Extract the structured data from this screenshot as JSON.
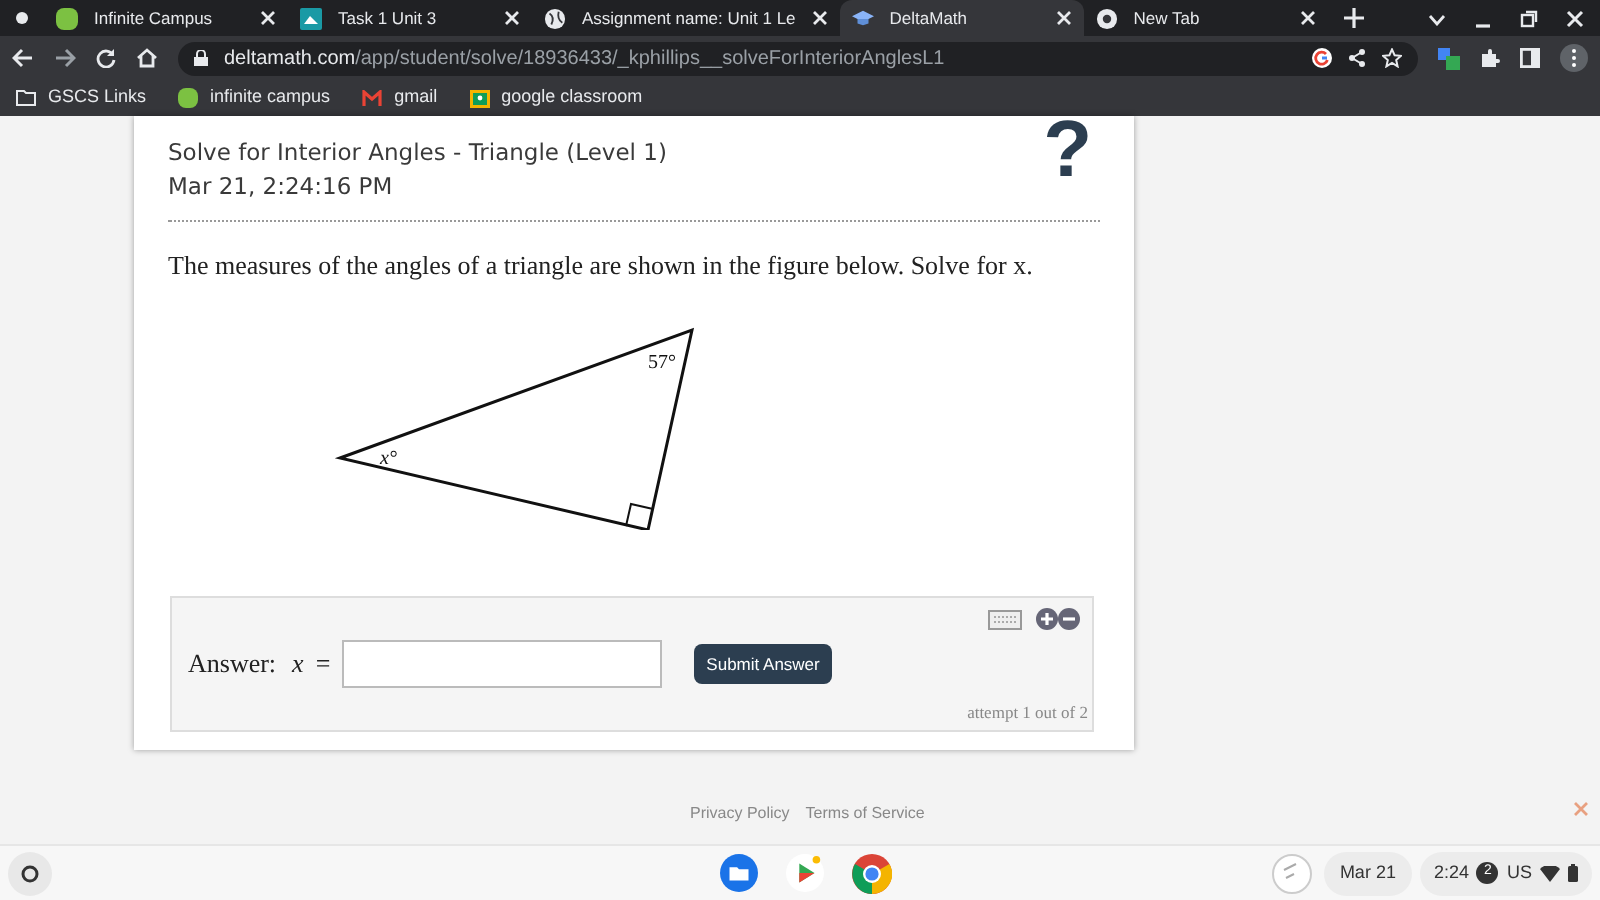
{
  "tabs": [
    {
      "kind": "pinned",
      "selected": false
    },
    {
      "label": "Infinite Campus",
      "kind": "campus",
      "selected": false
    },
    {
      "label": "Task 1 Unit 3",
      "kind": "task",
      "selected": false
    },
    {
      "label": "Assignment name: Unit 1 Le",
      "kind": "globe",
      "selected": false
    },
    {
      "label": "DeltaMath",
      "kind": "delta",
      "selected": true
    },
    {
      "label": "New Tab",
      "kind": "chrome",
      "selected": false
    }
  ],
  "address": {
    "host": "deltamath.com",
    "path": "/app/student/solve/18936433/_kphillips__solveForInteriorAnglesL1"
  },
  "bookmarks": [
    {
      "label": "GSCS Links",
      "kind": "folder"
    },
    {
      "label": "infinite campus",
      "kind": "campus"
    },
    {
      "label": "gmail",
      "kind": "gmail"
    },
    {
      "label": "google classroom",
      "kind": "classroom"
    }
  ],
  "problem": {
    "title": "Solve for Interior Angles - Triangle (Level 1)",
    "timestamp": "Mar 21, 2:24:16 PM",
    "help": "?",
    "question": "The measures of the angles of a triangle are shown in the figure below. Solve for x.",
    "angle_top": "57°",
    "angle_left": "x°"
  },
  "answer": {
    "label": "Answer:",
    "variable": "x",
    "equals": "=",
    "submit": "Submit Answer",
    "attempt": "attempt 1 out of 2"
  },
  "footer": {
    "links": [
      "Privacy Policy",
      "Terms of Service"
    ]
  },
  "shelf": {
    "date": "Mar 21",
    "time": "2:24",
    "notifications": "2",
    "keyboard": "US"
  }
}
